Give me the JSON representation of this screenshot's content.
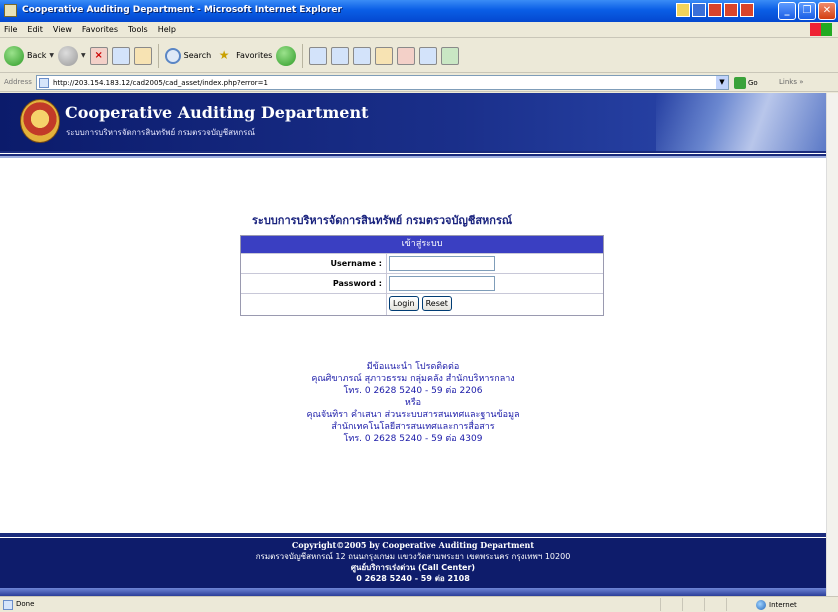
{
  "window": {
    "title": "Cooperative Auditing Department - Microsoft Internet Explorer"
  },
  "menu": [
    "File",
    "Edit",
    "View",
    "Favorites",
    "Tools",
    "Help"
  ],
  "toolbar": {
    "back": "Back",
    "search": "Search",
    "favorites": "Favorites"
  },
  "address": {
    "label": "Address",
    "url": "http://203.154.183.12/cad2005/cad_asset/index.php?error=1",
    "go": "Go",
    "links": "Links"
  },
  "header": {
    "title": "Cooperative Auditing Department",
    "subtitle": "ระบบการบริหารจัดการสินทรัพย์ กรมตรวจบัญชีสหกรณ์"
  },
  "system_title": "ระบบการบริหารจัดการสินทรัพย์ กรมตรวจบัญชีสหกรณ์",
  "login": {
    "heading": "เข้าสู่ระบบ",
    "username_label": "Username :",
    "password_label": "Password :",
    "username_value": "",
    "password_value": "",
    "login_button": "Login",
    "reset_button": "Reset"
  },
  "contact": [
    "มีข้อแนะนำ โปรดติดต่อ",
    "คุณศิขาภรณ์ สุภาวธรรม กลุ่มคลัง สำนักบริหารกลาง",
    "โทร. 0 2628 5240 - 59 ต่อ 2206",
    "หรือ",
    "คุณจันทิรา คำเสนา ส่วนระบบสารสนเทศและฐานข้อมูล",
    "สำนักเทคโนโลยีสารสนเทศและการสื่อสาร",
    "โทร. 0 2628 5240 - 59 ต่อ 4309"
  ],
  "footer": {
    "copyright": "Copyright©2005 by Cooperative Auditing Department",
    "address": "กรมตรวจบัญชีสหกรณ์ 12 ถนนกรุงเกษม แขวงวัดสามพระยา เขตพระนคร กรุงเทพฯ 10200",
    "callcenter": "ศูนย์บริการเร่งด่วน (Call Center)",
    "phone": "0 2628 5240 - 59 ต่อ 2108"
  },
  "status": {
    "text": "Done",
    "zone": "Internet"
  }
}
